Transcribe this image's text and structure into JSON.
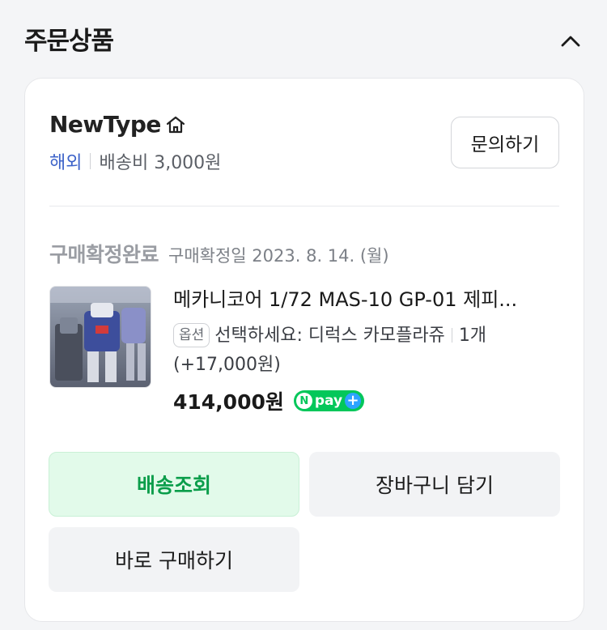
{
  "section": {
    "title": "주문상품",
    "collapse_icon": "chevron-up-icon"
  },
  "seller": {
    "name": "NewType",
    "home_icon": "home-icon",
    "region": "해외",
    "shipping_fee": "배송비 3,000원",
    "inquiry_label": "문의하기"
  },
  "order": {
    "status": "구매확정완료",
    "confirm_date": "구매확정일 2023. 8. 14. (월)"
  },
  "product": {
    "name": "메카니코어 1/72 MAS-10 GP-01 제피...",
    "option_badge": "옵션",
    "option_text": "선택하세요: 디럭스 카모플라쥬",
    "option_qty": "1개 (+17,000원)",
    "price": "414,000원",
    "npay_n": "N",
    "npay_label": "pay"
  },
  "buttons": {
    "track": "배송조회",
    "cart": "장바구니 담기",
    "buy_now": "바로 구매하기"
  },
  "colors": {
    "accent_green": "#0a9d4a",
    "region_blue": "#3d63c9",
    "npay_green": "#03c75a"
  }
}
